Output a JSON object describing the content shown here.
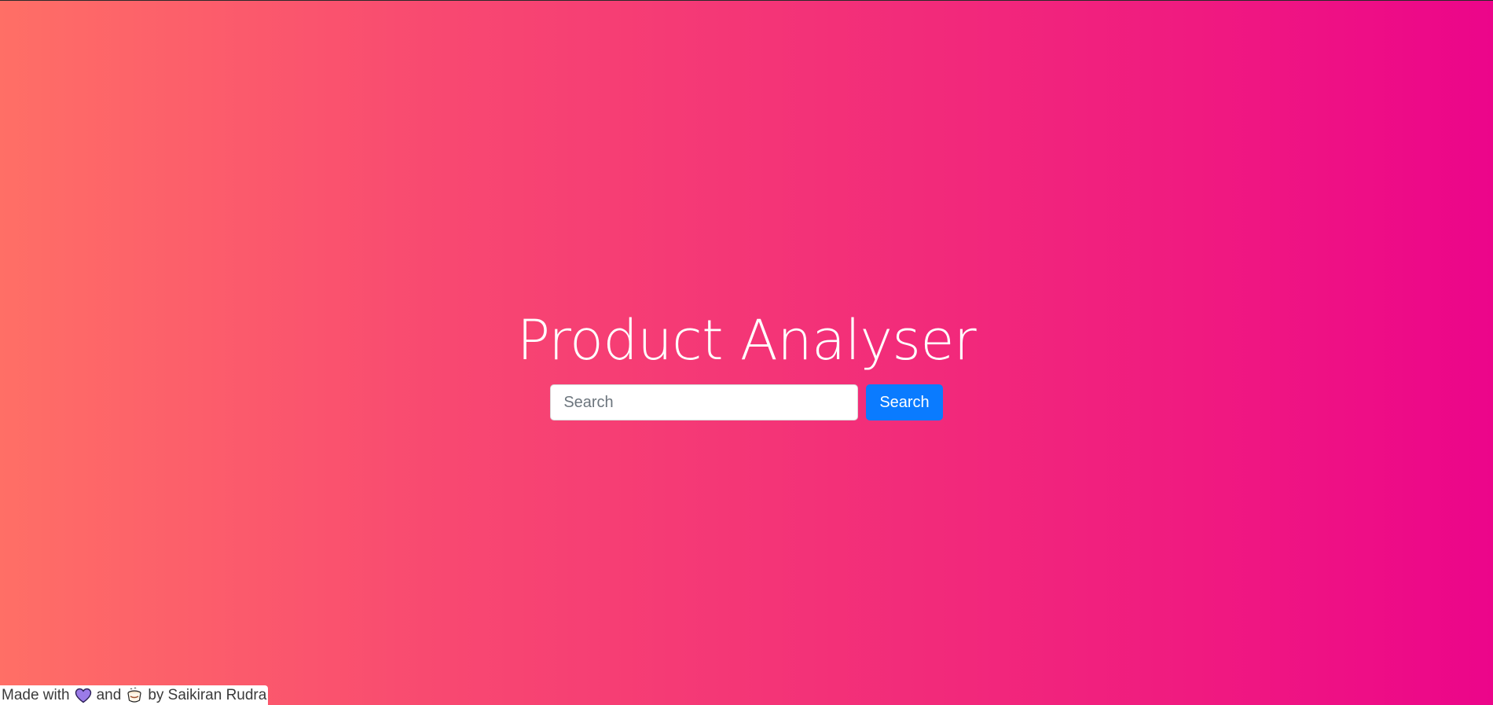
{
  "colors": {
    "gradient_start": "#ff6f66",
    "gradient_end": "#ec058a",
    "button_bg": "#0a7bff"
  },
  "hero": {
    "title": "Product Analyser",
    "search": {
      "placeholder": "Search",
      "value": ""
    },
    "search_button_label": "Search"
  },
  "footer": {
    "text_before": "Made with",
    "icon_1": "purple-heart-icon",
    "text_middle": "and",
    "icon_2": "coffee-cup-icon",
    "text_after": "by Saikiran Rudra"
  }
}
